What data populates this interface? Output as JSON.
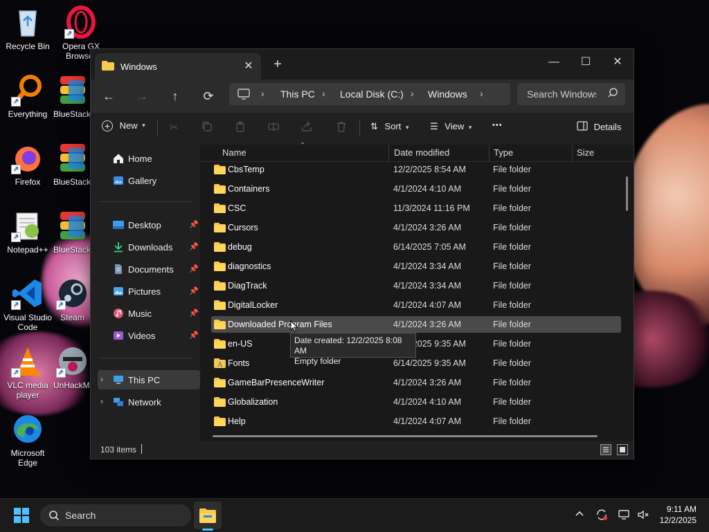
{
  "desktop": {
    "icons": [
      {
        "label": "Recycle Bin"
      },
      {
        "label": "Opera GX Browser"
      },
      {
        "label": "Everything"
      },
      {
        "label": "BlueStacks"
      },
      {
        "label": "Firefox"
      },
      {
        "label": "BlueStacks"
      },
      {
        "label": "Notepad++"
      },
      {
        "label": "BlueStacks"
      },
      {
        "label": "Visual Studio Code"
      },
      {
        "label": "Steam"
      },
      {
        "label": "VLC media player"
      },
      {
        "label": "UnHackMe"
      },
      {
        "label": "Microsoft Edge"
      }
    ]
  },
  "window": {
    "tab_title": "Windows",
    "tab_close": "✕",
    "new_tab": "+",
    "caption": {
      "minimize": "—",
      "maximize": "☐",
      "close": "✕"
    },
    "nav": {
      "back": "←",
      "forward": "→",
      "up": "↑",
      "refresh": "⟳"
    },
    "breadcrumb": [
      "This PC",
      "Local Disk (C:)",
      "Windows"
    ],
    "breadcrumb_chevron": "›",
    "search_placeholder": "Search Windows",
    "toolbar": {
      "new": "New",
      "sort": "Sort",
      "view": "View",
      "more": "•••",
      "details": "Details"
    },
    "navpane": {
      "home": "Home",
      "gallery": "Gallery",
      "quick_access": [
        {
          "label": "Desktop"
        },
        {
          "label": "Downloads"
        },
        {
          "label": "Documents"
        },
        {
          "label": "Pictures"
        },
        {
          "label": "Music"
        },
        {
          "label": "Videos"
        }
      ],
      "this_pc": "This PC",
      "network": "Network"
    },
    "columns": {
      "name": "Name",
      "date": "Date modified",
      "type": "Type",
      "size": "Size"
    },
    "files": [
      {
        "name": "CbsTemp",
        "date": "12/2/2025 8:54 AM",
        "type": "File folder"
      },
      {
        "name": "Containers",
        "date": "4/1/2024 4:10 AM",
        "type": "File folder"
      },
      {
        "name": "CSC",
        "date": "11/3/2024 11:16 PM",
        "type": "File folder"
      },
      {
        "name": "Cursors",
        "date": "4/1/2024 3:26 AM",
        "type": "File folder"
      },
      {
        "name": "debug",
        "date": "6/14/2025 7:05 AM",
        "type": "File folder"
      },
      {
        "name": "diagnostics",
        "date": "4/1/2024 3:34 AM",
        "type": "File folder"
      },
      {
        "name": "DiagTrack",
        "date": "4/1/2024 3:34 AM",
        "type": "File folder"
      },
      {
        "name": "DigitalLocker",
        "date": "4/1/2024 4:07 AM",
        "type": "File folder"
      },
      {
        "name": "Downloaded Program Files",
        "date": "4/1/2024 3:26 AM",
        "type": "File folder"
      },
      {
        "name": "en-US",
        "date": "6/14/2025 9:35 AM",
        "type": "File folder"
      },
      {
        "name": "Fonts",
        "date": "6/14/2025 9:35 AM",
        "type": "File folder"
      },
      {
        "name": "GameBarPresenceWriter",
        "date": "4/1/2024 3:26 AM",
        "type": "File folder"
      },
      {
        "name": "Globalization",
        "date": "4/1/2024 4:10 AM",
        "type": "File folder"
      },
      {
        "name": "Help",
        "date": "4/1/2024 4:07 AM",
        "type": "File folder"
      }
    ],
    "tooltip": {
      "line1": "Date created: 12/2/2025 8:08 AM",
      "line2": "Empty folder"
    },
    "status": {
      "items": "103 items"
    }
  },
  "taskbar": {
    "search_label": "Search",
    "time": "9:11 AM",
    "date": "12/2/2025"
  }
}
